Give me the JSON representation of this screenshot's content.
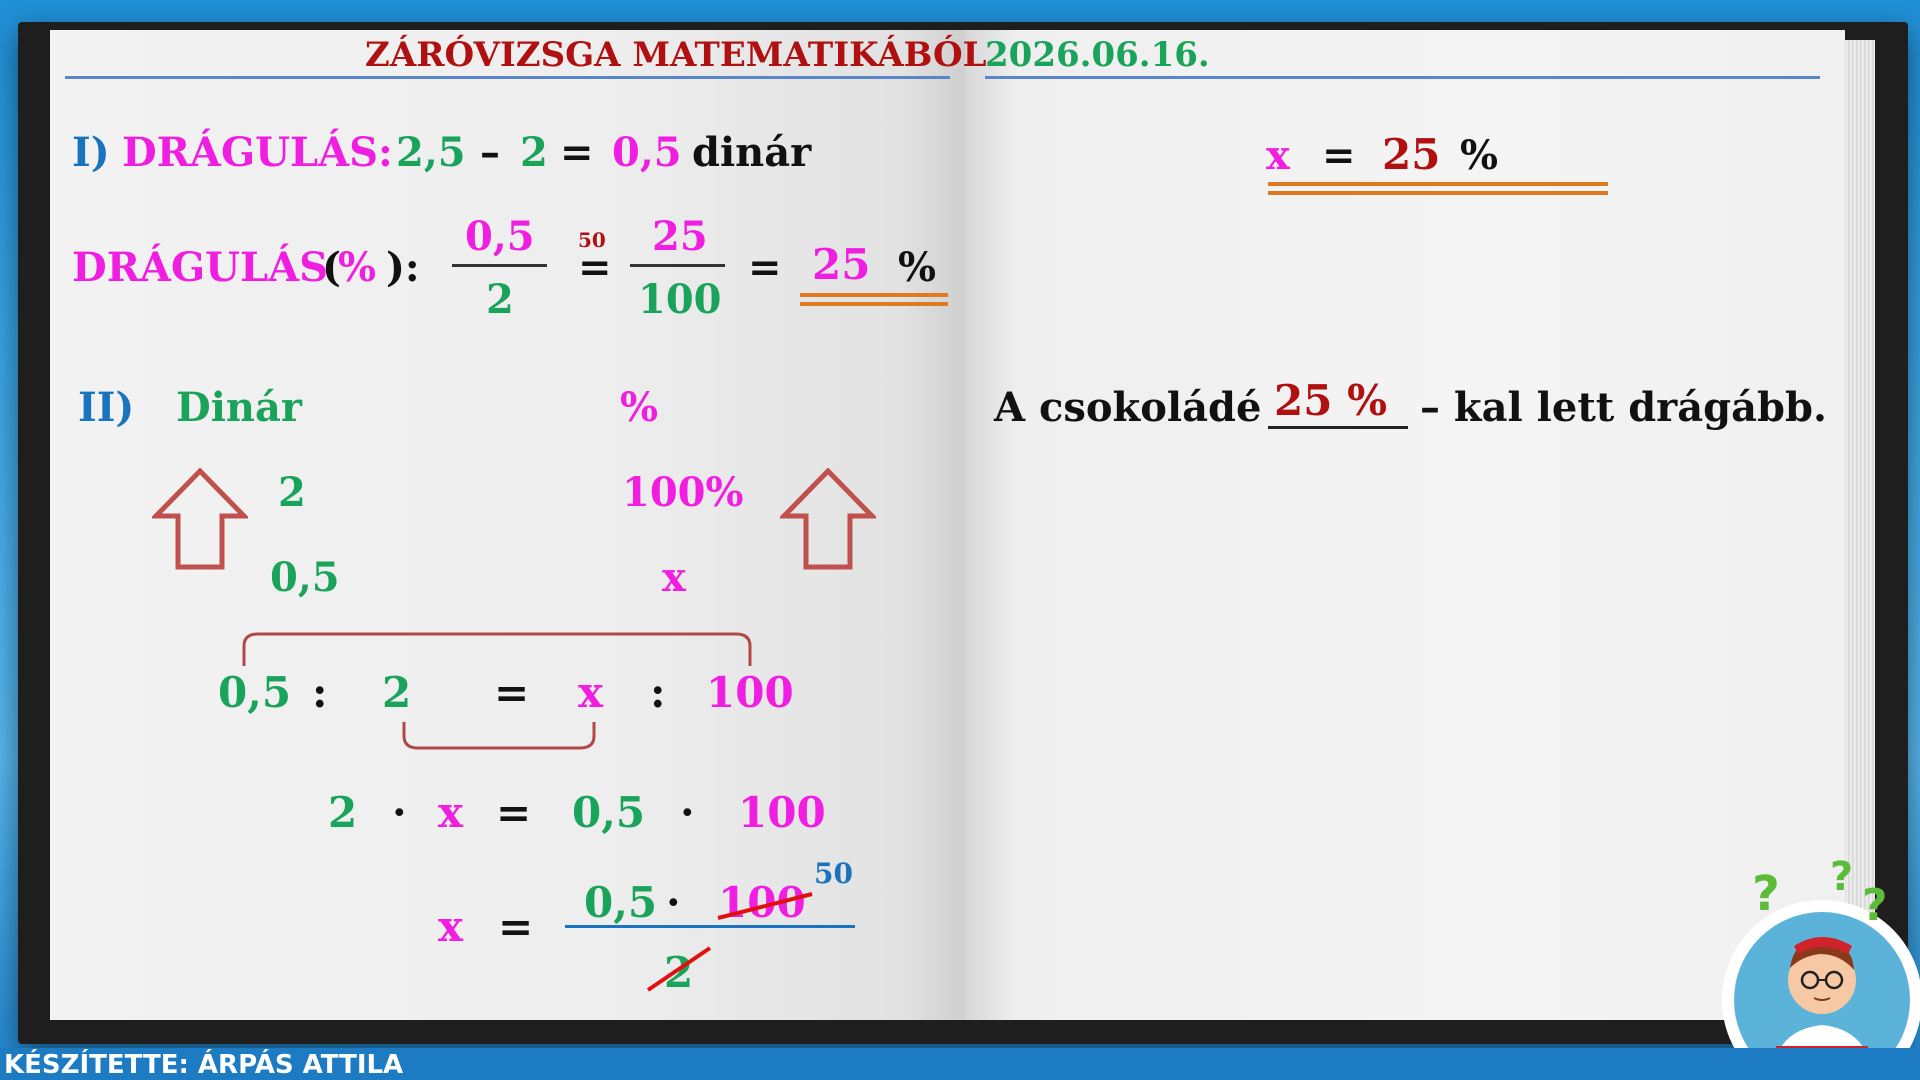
{
  "header": {
    "title": "ZÁRÓVIZSGA MATEMATIKÁBÓL",
    "date": "2026.06.16."
  },
  "section1": {
    "roman": "I)",
    "label": "DRÁGULÁS:",
    "a": "2,5",
    "minus": "–",
    "b": "2",
    "eq": "=",
    "result": "0,5",
    "unit": "dinár",
    "pct_label": "DRÁGULÁS",
    "pct_open": "(",
    "pct_sign": "%",
    "pct_close": "):",
    "frac1_num": "0,5",
    "frac1_den": "2",
    "factor": "50",
    "frac2_num": "25",
    "frac2_den": "100",
    "pct_result": "25",
    "pct_unit": "%"
  },
  "section2": {
    "roman": "II)",
    "col1_head": "Dinár",
    "col2_head": "%",
    "row1_col1": "2",
    "row1_col2": "100%",
    "row2_col1": "0,5",
    "row2_col2": "x",
    "prop": [
      "0,5",
      ":",
      "2",
      "=",
      "x",
      ":",
      "100"
    ],
    "eq2": [
      "2",
      "·",
      "x",
      "=",
      "0,5",
      "·",
      "100"
    ],
    "eq3_lhs": "x",
    "eq3_eq": "=",
    "eq3_num_a": "0,5",
    "eq3_dot": "·",
    "eq3_num_b": "100",
    "eq3_num_b_reduced": "50",
    "eq3_den": "2"
  },
  "right": {
    "x": "x",
    "eq": "=",
    "value": "25",
    "pct": "%",
    "sentence_start": "A csokoládé",
    "blank_value": "25 %",
    "sentence_end": "– kal lett drágább."
  },
  "footer": {
    "credit": "KÉSZÍTETTE: ÁRPÁS ATTILA"
  },
  "colors": {
    "green": "#1aa35a",
    "magenta": "#f01ee0",
    "blue": "#1a73bf",
    "dark_red": "#b01010",
    "underline_orange": "#e07a22",
    "arrow_red": "#c0504d"
  },
  "icons": {
    "up_arrow_left": "up-arrow-icon",
    "up_arrow_right": "up-arrow-icon",
    "mascot": "thinking-boy-avatar"
  }
}
